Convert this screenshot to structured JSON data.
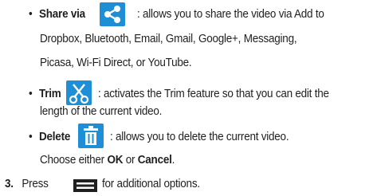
{
  "items": [
    {
      "term": "Share via",
      "icon": "share-icon",
      "lines": [
        ": allows you to share the video via Add to",
        "Dropbox, Bluetooth, Email, Gmail, Google+, Messaging,",
        "Picasa, Wi-Fi Direct, or YouTube."
      ]
    },
    {
      "term": "Trim",
      "icon": "scissors-icon",
      "lines": [
        ": activates the Trim feature so that you can edit the",
        "length of the current video."
      ]
    },
    {
      "term": "Delete",
      "icon": "trash-icon",
      "lines": [
        ": allows you to delete the current video.",
        "Choose either",
        "OK",
        "or",
        "Cancel",
        "."
      ]
    }
  ],
  "bullet": "•",
  "step": {
    "number": "3.",
    "text_before": "Press",
    "icon": "menu-icon",
    "text_after": "for additional options."
  },
  "colors": {
    "icon_background": "#1e8fd6",
    "icon_foreground": "#ffffff",
    "text": "#1f1f1f"
  }
}
